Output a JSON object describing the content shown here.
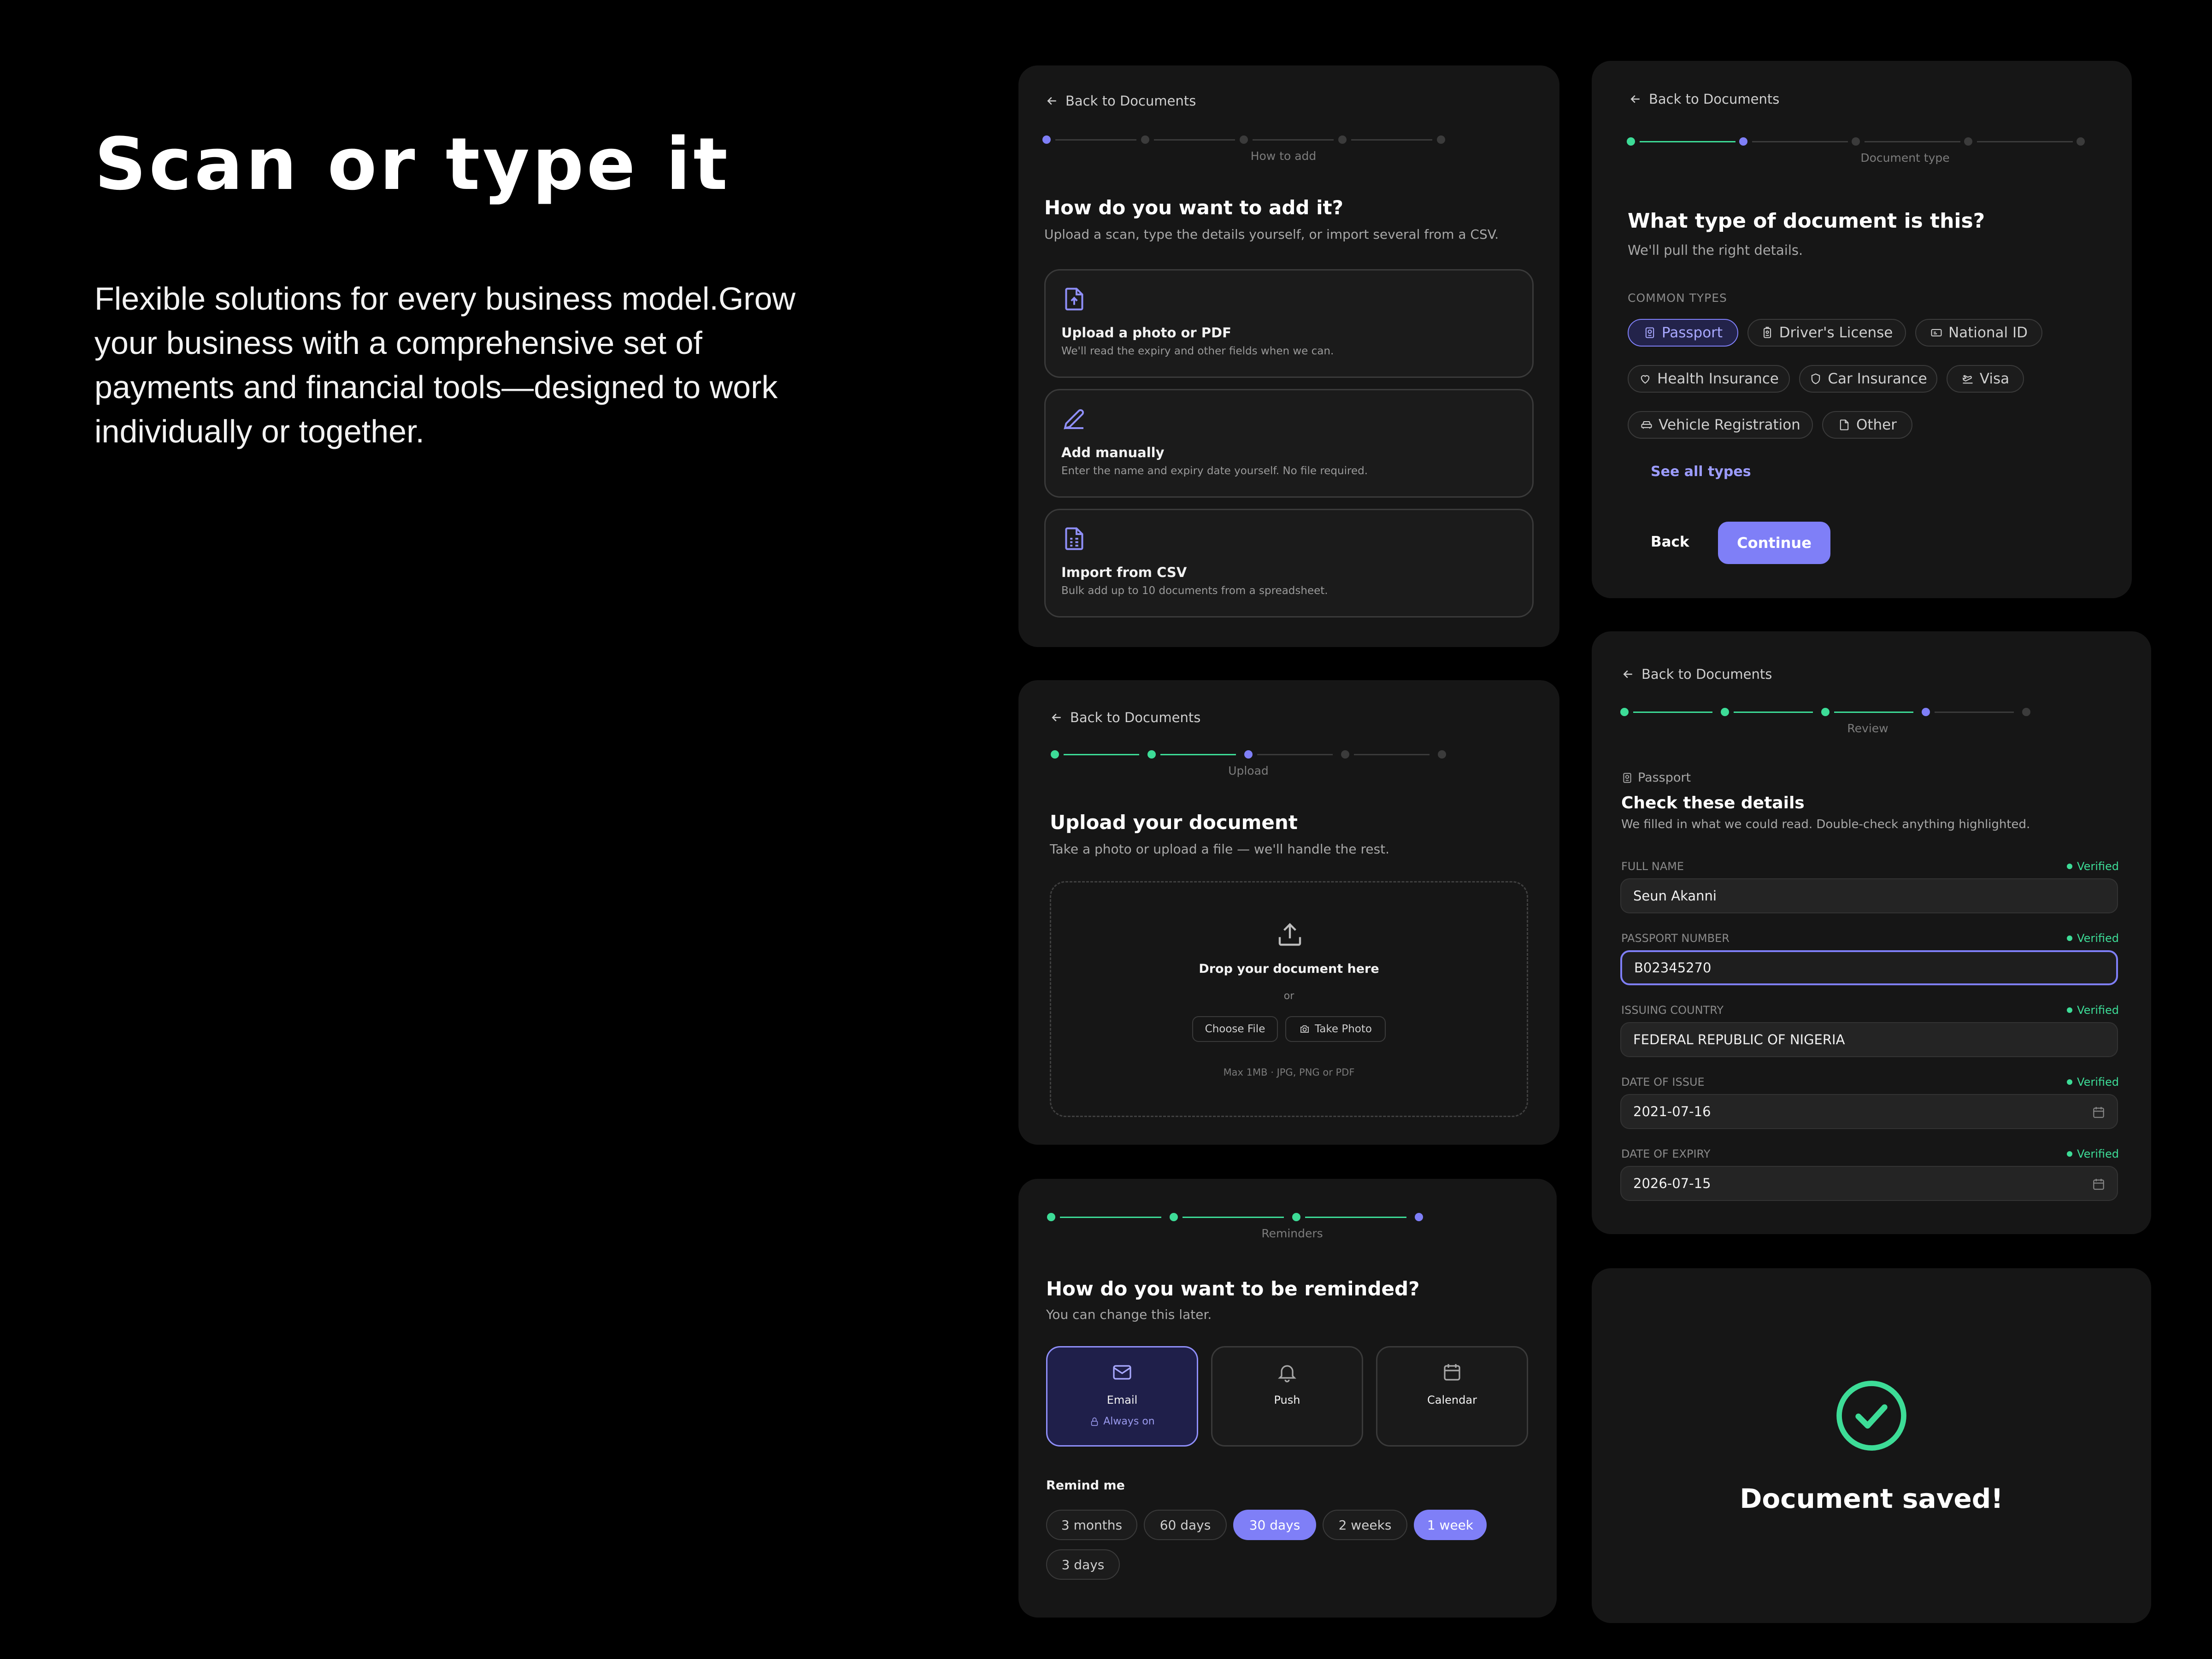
{
  "hero": {
    "title": "Scan or type it",
    "description": "Flexible solutions for every business model.Grow your business with a comprehensive set of payments and financial tools—designed to work individually or together."
  },
  "colors": {
    "accent": "#7f7ff7",
    "success": "#3ddc97",
    "background": "#000000",
    "card": "#161616"
  },
  "add_method": {
    "back_label": "Back to Documents",
    "step_label": "How to add",
    "title": "How do you want to add it?",
    "subtitle": "Upload a scan, type the details yourself, or import several from a CSV.",
    "options": [
      {
        "icon": "file-upload-icon",
        "title": "Upload a photo or PDF",
        "desc": "We'll read the expiry and other fields when we can."
      },
      {
        "icon": "pencil-icon",
        "title": "Add manually",
        "desc": "Enter the name and expiry date yourself. No file required."
      },
      {
        "icon": "spreadsheet-icon",
        "title": "Import from CSV",
        "desc": "Bulk add up to 10 documents from a spreadsheet."
      }
    ]
  },
  "doc_type": {
    "back_label": "Back to Documents",
    "step_label": "Document type",
    "title": "What type of document is this?",
    "subtitle": "We'll pull the right details.",
    "section_label": "COMMON TYPES",
    "types": [
      {
        "label": "Passport",
        "icon": "passport-icon",
        "selected": true
      },
      {
        "label": "Driver's License",
        "icon": "id-badge-icon"
      },
      {
        "label": "National ID",
        "icon": "id-card-icon"
      },
      {
        "label": "Health Insurance",
        "icon": "heart-icon"
      },
      {
        "label": "Car Insurance",
        "icon": "shield-icon"
      },
      {
        "label": "Visa",
        "icon": "plane-icon"
      },
      {
        "label": "Vehicle Registration",
        "icon": "car-icon"
      },
      {
        "label": "Other",
        "icon": "file-icon"
      }
    ],
    "see_all": "See all types",
    "back_button": "Back",
    "continue_button": "Continue"
  },
  "upload": {
    "back_label": "Back to Documents",
    "step_label": "Upload",
    "title": "Upload your document",
    "subtitle": "Take a photo or upload a file — we'll handle the rest.",
    "drop_label": "Drop your document here",
    "or": "or",
    "choose_file": "Choose File",
    "take_photo": "Take Photo",
    "hint": "Max 1MB · JPG, PNG or PDF"
  },
  "review": {
    "back_label": "Back to Documents",
    "step_label": "Review",
    "doc_kind": "Passport",
    "title": "Check these details",
    "subtitle": "We filled in what we could read. Double-check anything highlighted.",
    "verified_label": "Verified",
    "fields": [
      {
        "label": "FULL NAME",
        "value": "Seun Akanni"
      },
      {
        "label": "PASSPORT NUMBER",
        "value": "B02345270"
      },
      {
        "label": "ISSUING COUNTRY",
        "value": "FEDERAL REPUBLIC OF NIGERIA"
      },
      {
        "label": "DATE OF ISSUE",
        "value": "2021-07-16"
      },
      {
        "label": "DATE OF EXPIRY",
        "value": "2026-07-15"
      }
    ]
  },
  "reminders": {
    "step_label": "Reminders",
    "title": "How do you want to be reminded?",
    "subtitle": "You can change this later.",
    "channels": [
      {
        "label": "Email",
        "icon": "mail-icon",
        "note": "Always on",
        "selected": true
      },
      {
        "label": "Push",
        "icon": "bell-icon"
      },
      {
        "label": "Calendar",
        "icon": "calendar-icon"
      }
    ],
    "remind_label": "Remind me",
    "intervals": [
      {
        "label": "3 months",
        "selected": false
      },
      {
        "label": "60 days",
        "selected": false
      },
      {
        "label": "30 days",
        "selected": true
      },
      {
        "label": "2 weeks",
        "selected": false
      },
      {
        "label": "1 week",
        "selected": true
      },
      {
        "label": "3 days",
        "selected": false
      }
    ]
  },
  "saved": {
    "message": "Document saved!"
  }
}
